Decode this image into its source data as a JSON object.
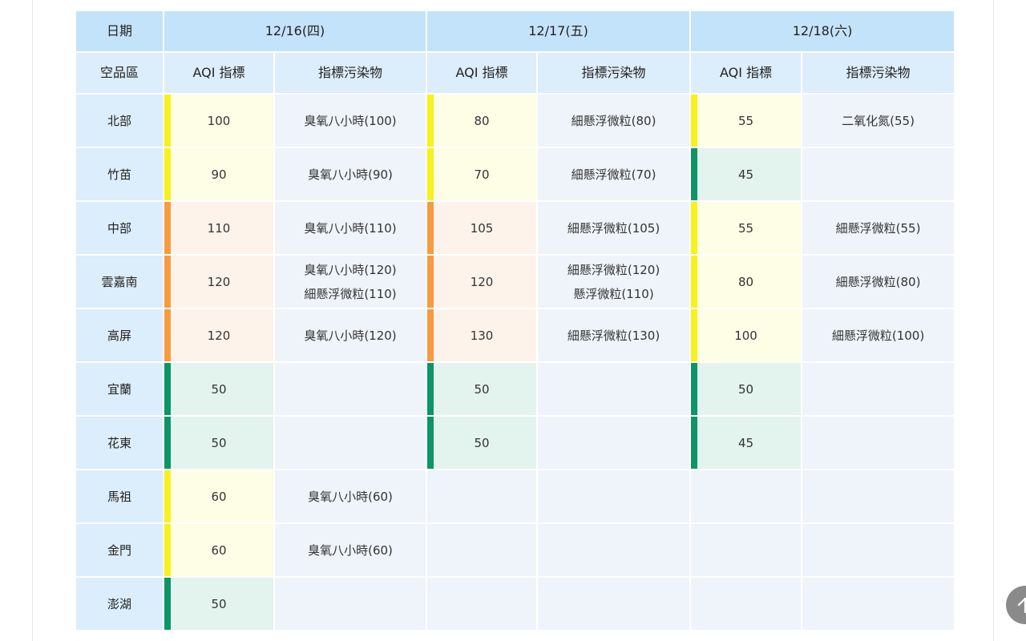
{
  "table": {
    "header_date": "日期",
    "header_area": "空品區",
    "dates": [
      "12/16(四)",
      "12/17(五)",
      "12/18(六)"
    ],
    "col_aqi": "AQI 指標",
    "col_pollutant": "指標污染物",
    "rows": [
      {
        "region": "北部",
        "d0": {
          "aqi": "100",
          "level": "yellow",
          "pol": [
            "臭氧八小時(100)"
          ]
        },
        "d1": {
          "aqi": "80",
          "level": "yellow",
          "pol": [
            "細懸浮微粒(80)"
          ]
        },
        "d2": {
          "aqi": "55",
          "level": "yellow",
          "pol": [
            "二氧化氮(55)"
          ]
        }
      },
      {
        "region": "竹苗",
        "d0": {
          "aqi": "90",
          "level": "yellow",
          "pol": [
            "臭氧八小時(90)"
          ]
        },
        "d1": {
          "aqi": "70",
          "level": "yellow",
          "pol": [
            "細懸浮微粒(70)"
          ]
        },
        "d2": {
          "aqi": "45",
          "level": "green",
          "pol": []
        }
      },
      {
        "region": "中部",
        "d0": {
          "aqi": "110",
          "level": "orange",
          "pol": [
            "臭氧八小時(110)"
          ]
        },
        "d1": {
          "aqi": "105",
          "level": "orange",
          "pol": [
            "細懸浮微粒(105)"
          ]
        },
        "d2": {
          "aqi": "55",
          "level": "yellow",
          "pol": [
            "細懸浮微粒(55)"
          ]
        }
      },
      {
        "region": "雲嘉南",
        "d0": {
          "aqi": "120",
          "level": "orange",
          "pol": [
            "臭氧八小時(120)",
            "細懸浮微粒(110)"
          ]
        },
        "d1": {
          "aqi": "120",
          "level": "orange",
          "pol": [
            "細懸浮微粒(120)",
            "懸浮微粒(110)"
          ]
        },
        "d2": {
          "aqi": "80",
          "level": "yellow",
          "pol": [
            "細懸浮微粒(80)"
          ]
        }
      },
      {
        "region": "高屏",
        "d0": {
          "aqi": "120",
          "level": "orange",
          "pol": [
            "臭氧八小時(120)"
          ]
        },
        "d1": {
          "aqi": "130",
          "level": "orange",
          "pol": [
            "細懸浮微粒(130)"
          ]
        },
        "d2": {
          "aqi": "100",
          "level": "yellow",
          "pol": [
            "細懸浮微粒(100)"
          ]
        }
      },
      {
        "region": "宜蘭",
        "d0": {
          "aqi": "50",
          "level": "green",
          "pol": []
        },
        "d1": {
          "aqi": "50",
          "level": "green",
          "pol": []
        },
        "d2": {
          "aqi": "50",
          "level": "green",
          "pol": []
        }
      },
      {
        "region": "花東",
        "d0": {
          "aqi": "50",
          "level": "green",
          "pol": []
        },
        "d1": {
          "aqi": "50",
          "level": "green",
          "pol": []
        },
        "d2": {
          "aqi": "45",
          "level": "green",
          "pol": []
        }
      },
      {
        "region": "馬祖",
        "d0": {
          "aqi": "60",
          "level": "yellow",
          "pol": [
            "臭氧八小時(60)"
          ]
        },
        "d1": null,
        "d2": null
      },
      {
        "region": "金門",
        "d0": {
          "aqi": "60",
          "level": "yellow",
          "pol": [
            "臭氧八小時(60)"
          ]
        },
        "d1": null,
        "d2": null
      },
      {
        "region": "澎湖",
        "d0": {
          "aqi": "50",
          "level": "green",
          "pol": []
        },
        "d1": null,
        "d2": null
      }
    ]
  },
  "colors": {
    "yellow": "#f7f11d",
    "orange": "#f69b42",
    "green": "#0c9566",
    "header_blue": "#c3e3fb"
  },
  "icons": {
    "scroll_top": "arrow-up-icon"
  }
}
